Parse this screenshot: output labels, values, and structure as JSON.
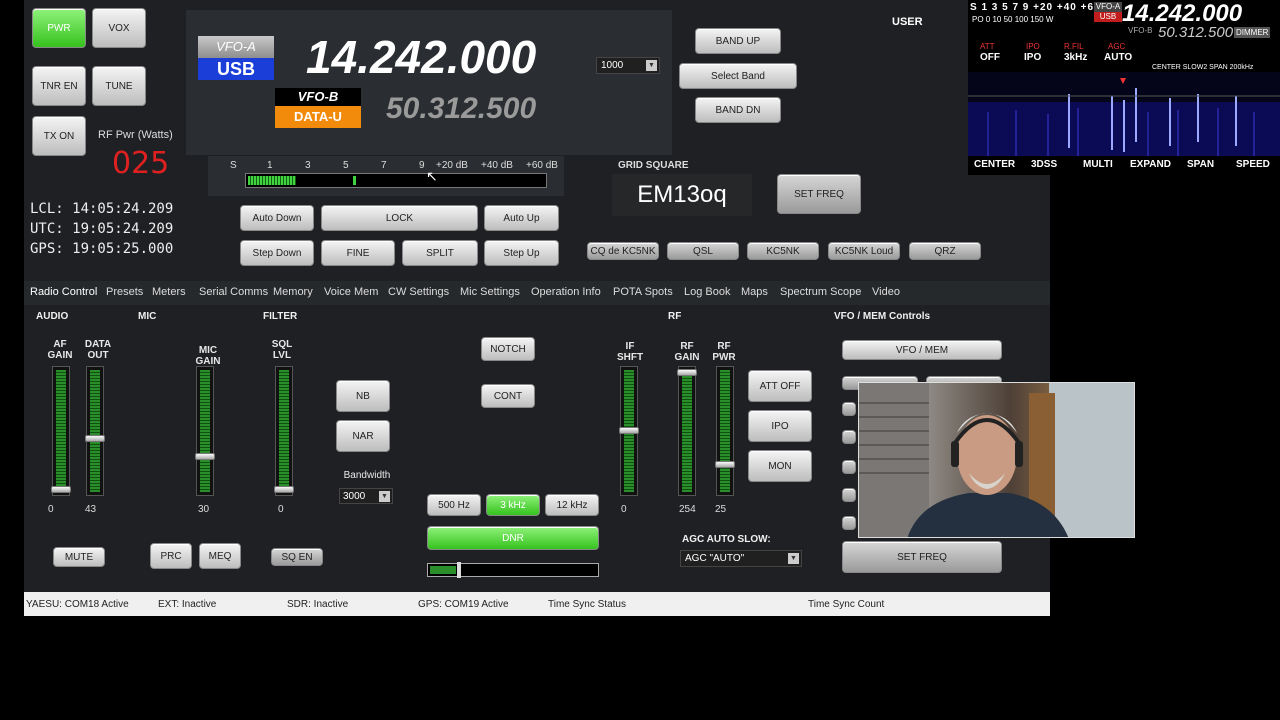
{
  "header": {
    "user": "USER"
  },
  "left": {
    "pwr": "PWR",
    "vox": "VOX",
    "tnr": "TNR EN",
    "tune": "TUNE",
    "tx": "TX ON",
    "rf_pwr_label": "RF Pwr (Watts)",
    "rf_pwr_value": "025",
    "lcl": "LCL: 14:05:24.209",
    "utc": "UTC: 19:05:24.209",
    "gps": "GPS: 19:05:25.000"
  },
  "vfo": {
    "vfo_a": "VFO-A",
    "mode_a": "USB",
    "freq_a": "14.242.000",
    "vfo_b": "VFO-B",
    "mode_b": "DATA-U",
    "freq_b": "50.312.500",
    "step_value": "1000"
  },
  "band": {
    "up": "BAND  UP",
    "select": "Select Band",
    "dn": "BAND  DN"
  },
  "smeter": {
    "ticks": [
      "S",
      "1",
      "3",
      "5",
      "7",
      "9",
      "+20 dB",
      "+40 dB",
      "+60 dB"
    ]
  },
  "tuning": {
    "auto_down": "Auto Down",
    "lock": "LOCK",
    "auto_up": "Auto Up",
    "step_down": "Step Down",
    "fine": "FINE",
    "split": "SPLIT",
    "step_up": "Step Up"
  },
  "grid": {
    "label": "GRID SQUARE",
    "value": "EM13oq",
    "set_freq": "SET FREQ"
  },
  "macros": [
    "CQ de KC5NK",
    "QSL",
    "KC5NK",
    "KC5NK Loud",
    "QRZ"
  ],
  "tabs": [
    "Radio Control",
    "Presets",
    "Meters",
    "Serial Comms",
    "Memory",
    "Voice Mem",
    "CW Settings",
    "Mic Settings",
    "Operation Info",
    "POTA Spots",
    "Log Book",
    "Maps",
    "Spectrum Scope",
    "Video"
  ],
  "audio": {
    "title": "AUDIO",
    "af_gain": "AF GAIN",
    "af_val": "0",
    "data_out": "DATA OUT",
    "data_val": "43",
    "mute": "MUTE"
  },
  "mic": {
    "title": "MIC",
    "mic_gain": "MIC GAIN",
    "mic_val": "30",
    "prc": "PRC",
    "meq": "MEQ"
  },
  "filter": {
    "title": "FILTER",
    "sql": "SQL LVL",
    "sql_val": "0",
    "sq_en": "SQ EN",
    "nb": "NB",
    "nar": "NAR",
    "bandwidth_label": "Bandwidth",
    "bandwidth_value": "3000",
    "notch": "NOTCH",
    "cont": "CONT",
    "if_shft": "IF SHFT",
    "if_val": "0",
    "w500": "500 Hz",
    "w3k": "3 kHz",
    "w12k": "12 kHz",
    "dnr": "DNR"
  },
  "rf": {
    "title": "RF",
    "rf_gain": "RF GAIN",
    "rf_gain_val": "254",
    "rf_pwr": "RF PWR",
    "rf_pwr_val": "25",
    "att": "ATT OFF",
    "ipo": "IPO",
    "mon": "MON",
    "agc_label": "AGC AUTO SLOW:",
    "agc_value": "AGC \"AUTO\""
  },
  "vfo_mem": {
    "title": "VFO / MEM Controls",
    "vfo_mem": "VFO / MEM",
    "set_freq": "SET FREQ"
  },
  "status": {
    "yaesu": "YAESU: COM18 Active",
    "ext": "EXT: Inactive",
    "sdr": "SDR: Inactive",
    "gps": "GPS: COM19 Active",
    "sync": "Time Sync Status",
    "count": "Time Sync Count"
  },
  "scope": {
    "att_label": "ATT",
    "att_val": "OFF",
    "ipo_label": "IPO",
    "ipo_val": "IPO",
    "rfil_label": "R.FIL",
    "rfil_val": "3kHz",
    "agc_label": "AGC",
    "agc_val": "AUTO",
    "freq_main": "14.242.000",
    "freq_sub": "50.312.500",
    "vfo_a": "VFO-A",
    "vfo_b": "VFO-B",
    "usb": "USB",
    "dimmer": "DIMMER",
    "span_info": "CENTER SLOW2 SPAN  200kHz",
    "scale_top": "S 1 3 5 7 9 +20 +40 +60",
    "scale_bot": "PO 0 10 50 100 150 W",
    "menu": [
      "CENTER",
      "3DSS",
      "MULTI",
      "EXPAND",
      "SPAN",
      "SPEED"
    ]
  },
  "colors": {
    "accent_green": "#35c21e",
    "freq_red": "#e02020",
    "vfo_blue": "#1b3ed8",
    "data_orange": "#f28a0c"
  }
}
